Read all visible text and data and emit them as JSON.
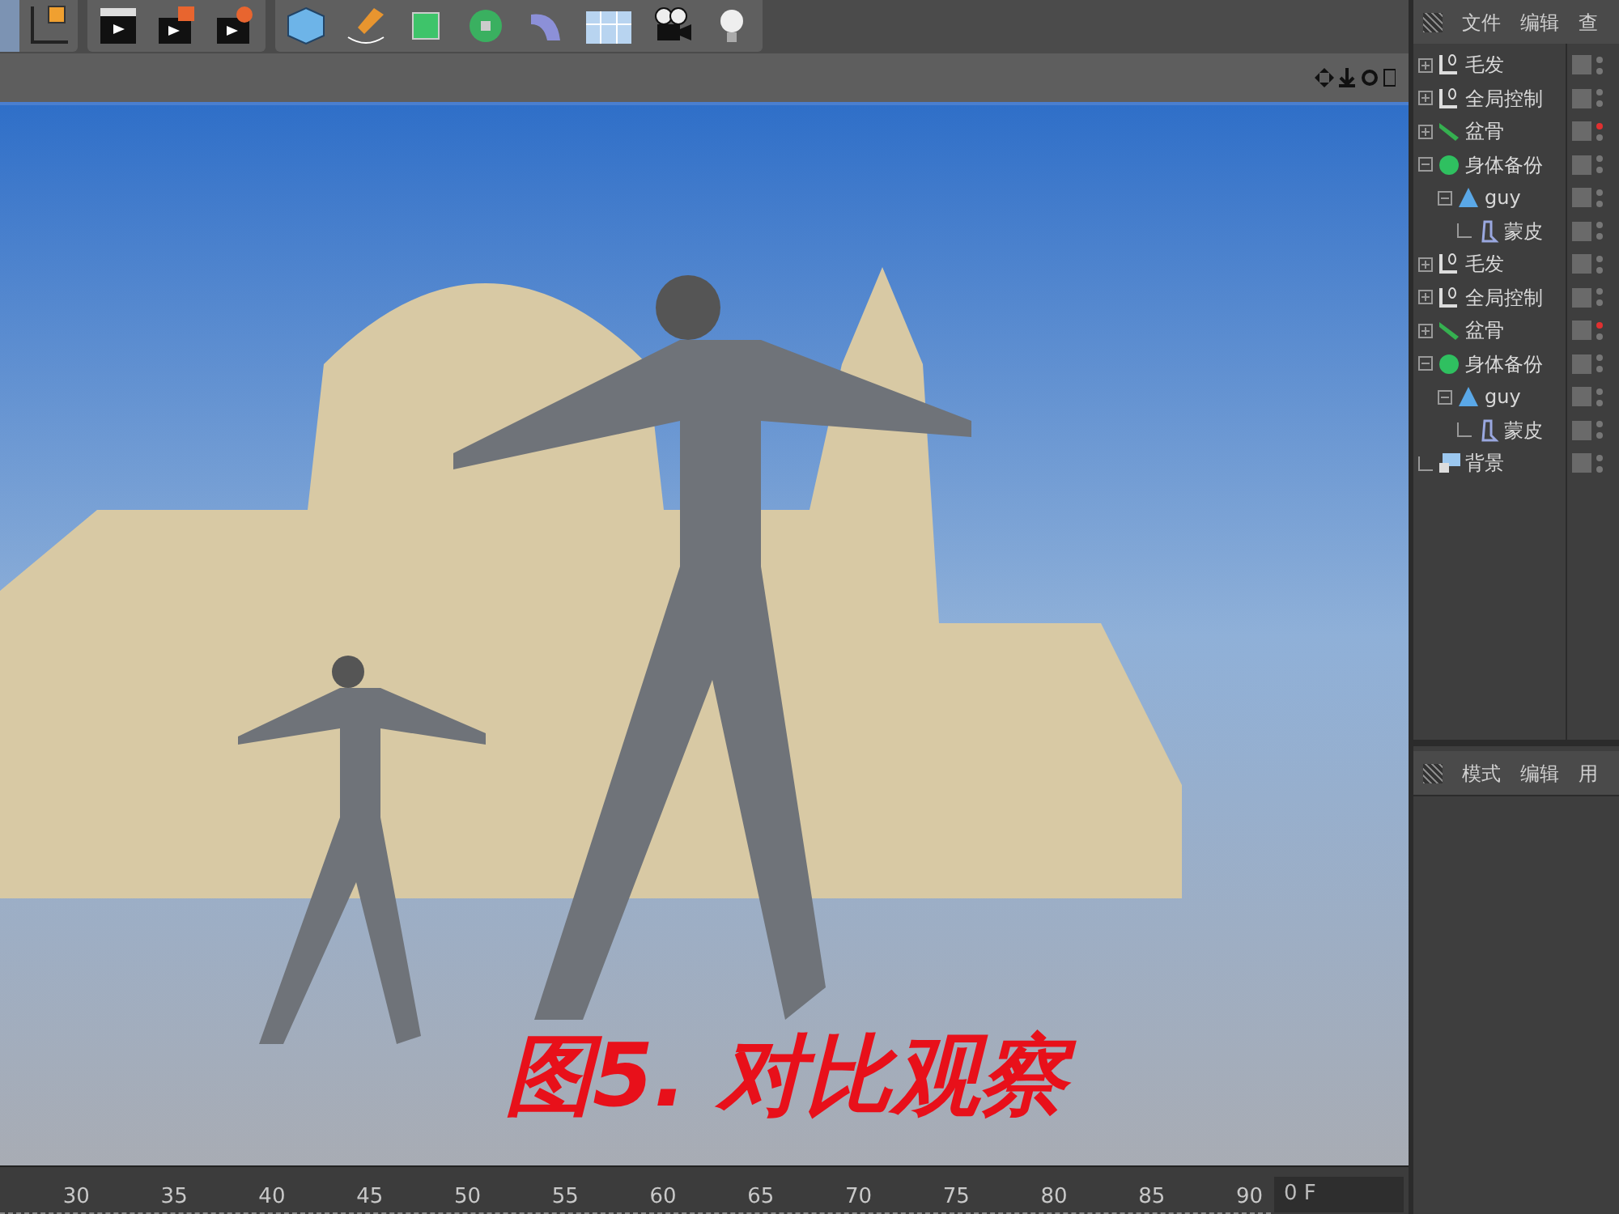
{
  "viewport": {
    "caption": "图5. 对比观察"
  },
  "object_manager": {
    "menu": [
      "文件",
      "编辑",
      "查"
    ],
    "objects": [
      {
        "name": "毛发",
        "kind": "null",
        "expanded": false,
        "red_dot": false
      },
      {
        "name": "全局控制",
        "kind": "null",
        "expanded": false,
        "red_dot": false
      },
      {
        "name": "盆骨",
        "kind": "bone",
        "expanded": false,
        "red_dot": true
      },
      {
        "name": "身体备份",
        "kind": "joint",
        "expanded": true,
        "red_dot": false,
        "children": [
          {
            "name": "guy",
            "kind": "polygon",
            "expanded": true,
            "red_dot": false,
            "children": [
              {
                "name": "蒙皮",
                "kind": "skin",
                "red_dot": false
              }
            ]
          }
        ]
      },
      {
        "name": "毛发",
        "kind": "null",
        "expanded": false,
        "red_dot": false
      },
      {
        "name": "全局控制",
        "kind": "null",
        "expanded": false,
        "red_dot": false
      },
      {
        "name": "盆骨",
        "kind": "bone",
        "expanded": false,
        "red_dot": true
      },
      {
        "name": "身体备份",
        "kind": "joint",
        "expanded": true,
        "red_dot": false,
        "children": [
          {
            "name": "guy",
            "kind": "polygon",
            "expanded": true,
            "red_dot": false,
            "children": [
              {
                "name": "蒙皮",
                "kind": "skin",
                "red_dot": false
              }
            ]
          }
        ]
      },
      {
        "name": "背景",
        "kind": "background",
        "red_dot": false
      }
    ]
  },
  "attribute_manager": {
    "menu": [
      "模式",
      "编辑",
      "用"
    ]
  },
  "timeline": {
    "ticks": [
      "30",
      "35",
      "40",
      "45",
      "50",
      "55",
      "60",
      "65",
      "70",
      "75",
      "80",
      "85",
      "90"
    ],
    "frame": "0 F"
  }
}
